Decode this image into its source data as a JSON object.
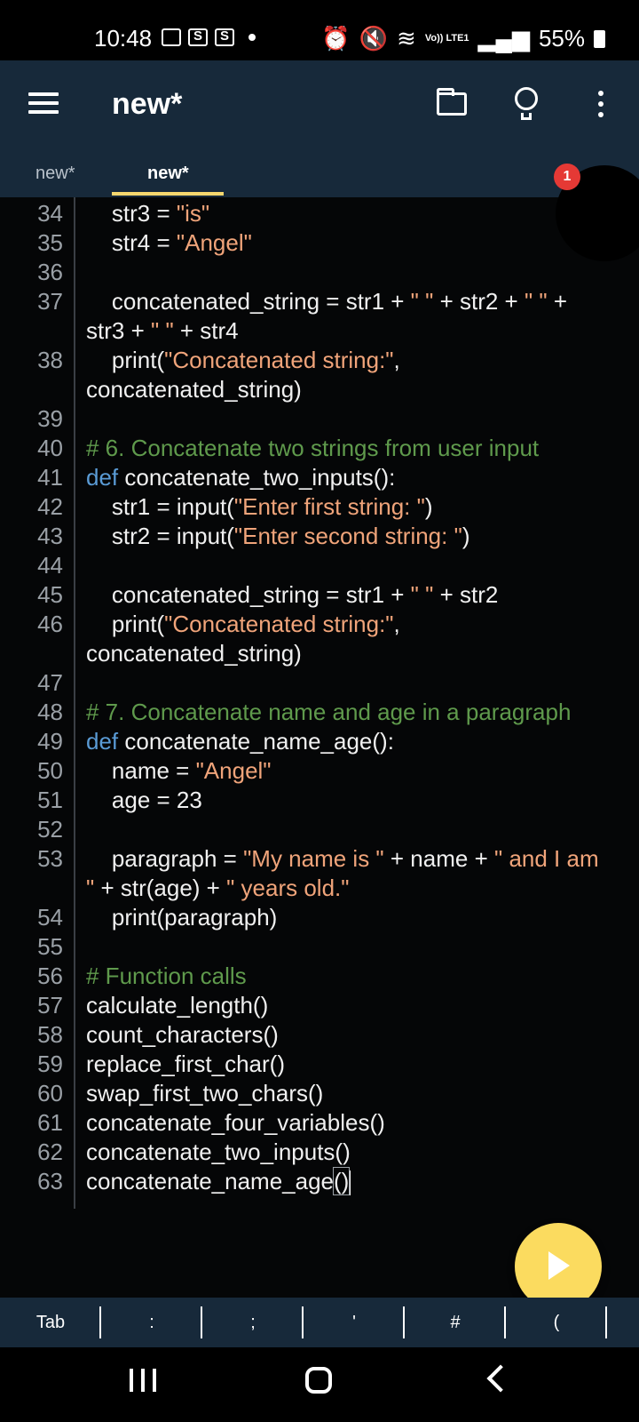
{
  "status_bar": {
    "time": "10:48",
    "battery": "55%",
    "network": "Vo)) LTE1"
  },
  "toolbar": {
    "title": "new*"
  },
  "tabs": [
    {
      "label": "new*"
    },
    {
      "label": "new*"
    }
  ],
  "notification_badge": "1",
  "editor": {
    "lines": [
      {
        "n": "34",
        "html": "    str3 = <span class='str'>\"is\"</span>"
      },
      {
        "n": "35",
        "html": "    str4 = <span class='str'>\"Angel\"</span>"
      },
      {
        "n": "36",
        "html": ""
      },
      {
        "n": "37",
        "html": "    concatenated_string = str1 + <span class='str'>\" \"</span> + str2 + <span class='str'>\" \"</span> +"
      },
      {
        "n": "",
        "html": "str3 + <span class='str'>\" \"</span> + str4"
      },
      {
        "n": "38",
        "html": "    print(<span class='str'>\"Concatenated string:\"</span>,"
      },
      {
        "n": "",
        "html": "concatenated_string)"
      },
      {
        "n": "39",
        "html": ""
      },
      {
        "n": "40",
        "html": "<span class='cm'># 6. Concatenate two strings from user input</span>"
      },
      {
        "n": "41",
        "html": "<span class='kw'>def</span> concatenate_two_inputs():"
      },
      {
        "n": "42",
        "html": "    str1 = input(<span class='str'>\"Enter first string: \"</span>)"
      },
      {
        "n": "43",
        "html": "    str2 = input(<span class='str'>\"Enter second string: \"</span>)"
      },
      {
        "n": "44",
        "html": ""
      },
      {
        "n": "45",
        "html": "    concatenated_string = str1 + <span class='str'>\" \"</span> + str2"
      },
      {
        "n": "46",
        "html": "    print(<span class='str'>\"Concatenated string:\"</span>,"
      },
      {
        "n": "",
        "html": "concatenated_string)"
      },
      {
        "n": "47",
        "html": ""
      },
      {
        "n": "48",
        "html": "<span class='cm'># 7. Concatenate name and age in a paragraph</span>"
      },
      {
        "n": "49",
        "html": "<span class='kw'>def</span> concatenate_name_age():"
      },
      {
        "n": "50",
        "html": "    name = <span class='str'>\"Angel\"</span>"
      },
      {
        "n": "51",
        "html": "    age = 23"
      },
      {
        "n": "52",
        "html": ""
      },
      {
        "n": "53",
        "html": "    paragraph = <span class='str'>\"My name is \"</span> + name + <span class='str'>\" and I am</span>"
      },
      {
        "n": "",
        "html": "<span class='str'>\"</span> + str(age) + <span class='str'>\" years old.\"</span>"
      },
      {
        "n": "54",
        "html": "    print(paragraph)"
      },
      {
        "n": "55",
        "html": ""
      },
      {
        "n": "56",
        "html": "<span class='cm'># Function calls</span>"
      },
      {
        "n": "57",
        "html": "calculate_length()"
      },
      {
        "n": "58",
        "html": "count_characters()"
      },
      {
        "n": "59",
        "html": "replace_first_char()"
      },
      {
        "n": "60",
        "html": "swap_first_two_chars()"
      },
      {
        "n": "61",
        "html": "concatenate_four_variables()"
      },
      {
        "n": "62",
        "html": "concatenate_two_inputs()"
      },
      {
        "n": "63",
        "html": "concatenate_name_age<span class='paren-hl'>()</span><span class='cursor'></span>"
      }
    ]
  },
  "keybar": {
    "keys": [
      "Tab",
      ":",
      ";",
      "'",
      "#",
      "("
    ]
  },
  "colors": {
    "toolbar": "#17293a",
    "fab": "#fbdb5f",
    "tab_underline": "#f5d76e",
    "keyword": "#5a9bd5",
    "string": "#f0a47a",
    "comment": "#5f9a4c"
  }
}
